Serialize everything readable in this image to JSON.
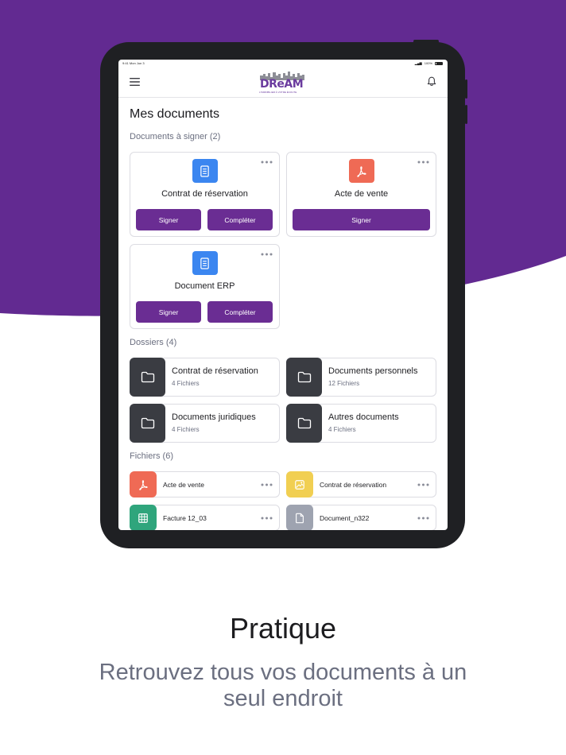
{
  "colors": {
    "brand_purple": "#622a91",
    "button_purple": "#6a2d93",
    "doc_blue": "#3b86f0",
    "pdf_red": "#ef6a55",
    "folder_dark": "#3a3c42",
    "image_yellow": "#f1cf52",
    "sheet_green": "#2fa57c",
    "file_grey": "#9ea3b0"
  },
  "status_bar": {
    "time": "9:41 Mon Jun 3",
    "battery": "100%"
  },
  "app": {
    "logo_text": "DReAM",
    "logo_tagline": "L'IMMOBILIER À VOTRE ÉCOUTE",
    "menu_icon": "hamburger-icon",
    "bell_icon": "bell-icon"
  },
  "page_title": "Mes documents",
  "sign_section": {
    "title": "Documents à signer (2)",
    "cards": [
      {
        "name": "Contrat de réservation",
        "icon": "document-icon",
        "sign_label": "Signer",
        "complete_label": "Compléter"
      },
      {
        "name": "Acte de vente",
        "icon": "pdf-icon",
        "sign_label": "Signer"
      },
      {
        "name": "Document ERP",
        "icon": "document-icon",
        "sign_label": "Signer",
        "complete_label": "Compléter"
      }
    ]
  },
  "folders_section": {
    "title": "Dossiers (4)",
    "folders": [
      {
        "name": "Contrat de réservation",
        "count": "4 Fichiers"
      },
      {
        "name": "Documents personnels",
        "count": "12 Fichiers"
      },
      {
        "name": "Documents juridiques",
        "count": "4 Fichiers"
      },
      {
        "name": "Autres documents",
        "count": "4 Fichiers"
      }
    ]
  },
  "files_section": {
    "title": "Fichiers (6)",
    "files": [
      {
        "name": "Acte de vente",
        "icon": "pdf-icon"
      },
      {
        "name": "Contrat de réservation",
        "icon": "image-icon"
      },
      {
        "name": "Facture 12_03",
        "icon": "spreadsheet-icon"
      },
      {
        "name": "Document_n322",
        "icon": "file-icon"
      }
    ]
  },
  "marketing": {
    "headline": "Pratique",
    "subline_1": "Retrouvez tous vos documents à un",
    "subline_2": "seul endroit"
  }
}
